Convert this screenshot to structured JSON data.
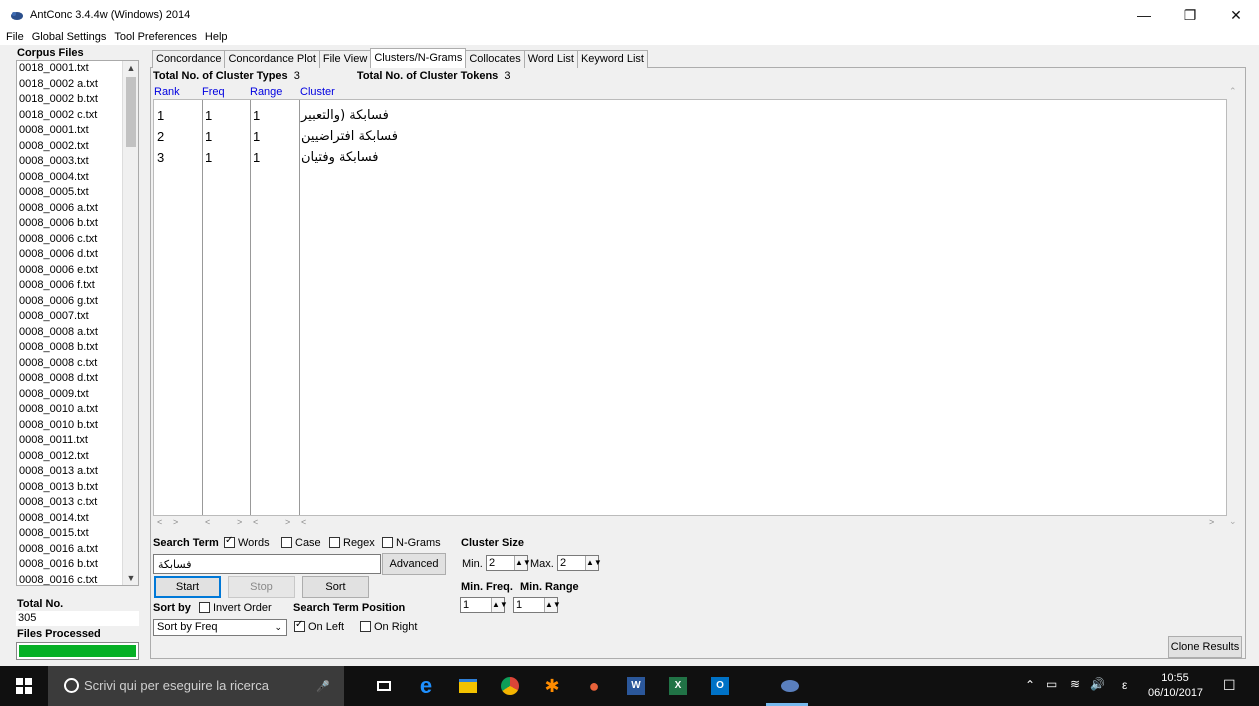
{
  "window": {
    "title": "AntConc 3.4.4w (Windows) 2014",
    "controls": [
      "minimize-icon",
      "restore-icon",
      "close-icon"
    ]
  },
  "menu": [
    "File",
    "Global Settings",
    "Tool Preferences",
    "Help"
  ],
  "corpus": {
    "title": "Corpus Files",
    "files": [
      "0018_0001.txt",
      "0018_0002 a.txt",
      "0018_0002 b.txt",
      "0018_0002 c.txt",
      "0008_0001.txt",
      "0008_0002.txt",
      "0008_0003.txt",
      "0008_0004.txt",
      "0008_0005.txt",
      "0008_0006 a.txt",
      "0008_0006 b.txt",
      "0008_0006 c.txt",
      "0008_0006 d.txt",
      "0008_0006 e.txt",
      "0008_0006 f.txt",
      "0008_0006 g.txt",
      "0008_0007.txt",
      "0008_0008 a.txt",
      "0008_0008 b.txt",
      "0008_0008 c.txt",
      "0008_0008 d.txt",
      "0008_0009.txt",
      "0008_0010 a.txt",
      "0008_0010 b.txt",
      "0008_0011.txt",
      "0008_0012.txt",
      "0008_0013 a.txt",
      "0008_0013 b.txt",
      "0008_0013 c.txt",
      "0008_0014.txt",
      "0008_0015.txt",
      "0008_0016 a.txt",
      "0008_0016 b.txt",
      "0008_0016 c.txt"
    ],
    "total_label": "Total No.",
    "total_value": "305",
    "files_processed_label": "Files Processed",
    "progress": 1.0
  },
  "tabs": [
    "Concordance",
    "Concordance Plot",
    "File View",
    "Clusters/N-Grams",
    "Collocates",
    "Word List",
    "Keyword List"
  ],
  "active_tab": "Clusters/N-Grams",
  "stats": {
    "types_label": "Total No. of Cluster Types",
    "types_value": "3",
    "tokens_label": "Total No. of Cluster Tokens",
    "tokens_value": "3"
  },
  "columns": [
    "Rank",
    "Freq",
    "Range",
    "Cluster"
  ],
  "rows": [
    {
      "rank": "1",
      "freq": "1",
      "range": "1",
      "cluster": "فسابكة (والتعبير"
    },
    {
      "rank": "2",
      "freq": "1",
      "range": "1",
      "cluster": "فسابكة افتراضيين"
    },
    {
      "rank": "3",
      "freq": "1",
      "range": "1",
      "cluster": "فسابكة وفتيان"
    }
  ],
  "search": {
    "label": "Search Term",
    "words": "Words",
    "case": "Case",
    "regex": "Regex",
    "ngrams": "N-Grams",
    "value": "فسابكة",
    "advanced": "Advanced"
  },
  "cluster_size": {
    "label": "Cluster Size",
    "min_label": "Min.",
    "min_value": "2",
    "max_label": "Max.",
    "max_value": "2"
  },
  "min_freq": {
    "label": "Min. Freq.",
    "value": "1"
  },
  "min_range": {
    "label": "Min. Range",
    "value": "1"
  },
  "buttons": {
    "start": "Start",
    "stop": "Stop",
    "sort": "Sort",
    "clone": "Clone Results"
  },
  "sort": {
    "label": "Sort by",
    "invert": "Invert Order",
    "selected": "Sort by Freq"
  },
  "position": {
    "label": "Search Term Position",
    "left": "On Left",
    "right": "On Right"
  },
  "taskbar": {
    "search_placeholder": "Scrivi qui per eseguire la ricerca",
    "time": "10:55",
    "date": "06/10/2017",
    "lang": "ε"
  }
}
